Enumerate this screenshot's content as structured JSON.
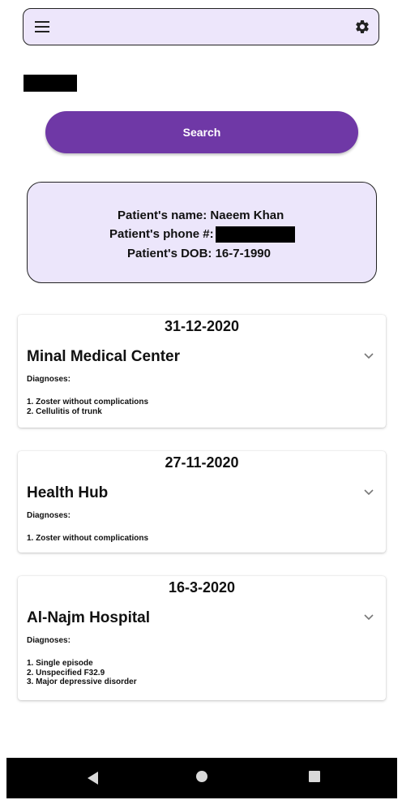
{
  "top_bar": {
    "menu_icon": "menu-icon",
    "settings_icon": "gear-icon",
    "background": "#ede6fb"
  },
  "search": {
    "button_label": "Search",
    "button_color": "#6f38a6"
  },
  "patient": {
    "name_line": "Patient's name: Naeem Khan",
    "phone_label": "Patient's phone #:",
    "dob_line": "Patient's DOB: 16-7-1990",
    "card_color": "#ece6fb"
  },
  "visits": [
    {
      "date": "31-12-2020",
      "hospital": "Minal Medical Center",
      "diagnoses_label": "Diagnoses:",
      "diagnoses": [
        "1. Zoster without complications",
        "2. Cellulitis of trunk"
      ]
    },
    {
      "date": "27-11-2020",
      "hospital": "Health Hub",
      "diagnoses_label": "Diagnoses:",
      "diagnoses": [
        "1. Zoster without complications"
      ]
    },
    {
      "date": "16-3-2020",
      "hospital": "Al-Najm Hospital",
      "diagnoses_label": "Diagnoses:",
      "diagnoses": [
        "1. Single episode",
        "2. Unspecified F32.9",
        "3. Major depressive disorder"
      ]
    }
  ],
  "system_nav": {
    "back_icon": "back-triangle-icon",
    "home_icon": "home-circle-icon",
    "recents_icon": "recents-square-icon"
  }
}
